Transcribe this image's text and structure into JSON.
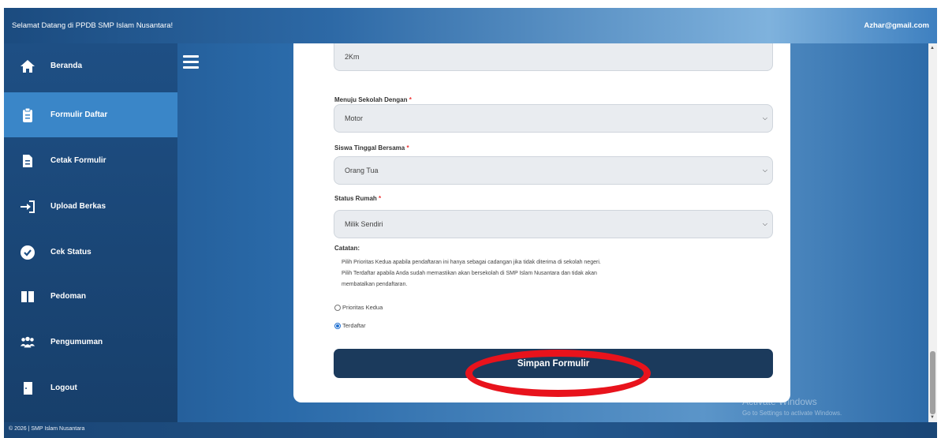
{
  "header": {
    "welcome": "Selamat Datang di PPDB SMP Islam Nusantara!",
    "email": "Azhar@gmail.com"
  },
  "sidebar": {
    "items": [
      {
        "label": "Beranda",
        "icon": "home-icon"
      },
      {
        "label": "Formulir Daftar",
        "icon": "clipboard-icon",
        "active": true
      },
      {
        "label": "Cetak Formulir",
        "icon": "file-icon"
      },
      {
        "label": "Upload Berkas",
        "icon": "sign-in-icon"
      },
      {
        "label": "Cek Status",
        "icon": "check-circle-icon"
      },
      {
        "label": "Pedoman",
        "icon": "book-icon"
      },
      {
        "label": "Pengumuman",
        "icon": "users-icon"
      },
      {
        "label": "Logout",
        "icon": "door-icon"
      }
    ]
  },
  "form": {
    "distance_value": "2Km",
    "transport_label": "Menuju Sekolah Dengan",
    "transport_value": "Motor",
    "living_label": "Siswa Tinggal Bersama",
    "living_value": "Orang Tua",
    "house_label": "Status Rumah",
    "house_value": "Milik Sendiri",
    "required_mark": "*",
    "note_title": "Catatan:",
    "note_lines": [
      "Pilih Prioritas Kedua apabila pendaftaran ini hanya sebagai cadangan jika tidak diterima di sekolah negeri.",
      "Pilih Terdaftar apabila Anda sudah memastikan akan bersekolah di SMP Islam Nusantara dan tidak akan",
      "membatalkan pendaftaran."
    ],
    "options": [
      {
        "label": "Prioritas Kedua",
        "checked": false
      },
      {
        "label": "Terdaftar",
        "checked": true
      }
    ],
    "submit_label": "Simpan Formulir"
  },
  "footer": {
    "copyright": "© 2026 | SMP Islam Nusantara"
  },
  "watermark": {
    "title": "Activate Windows",
    "subtitle": "Go to Settings to activate Windows."
  },
  "colors": {
    "accent": "#3a86c8",
    "button": "#1b3a5c",
    "highlight": "#e8131c"
  }
}
